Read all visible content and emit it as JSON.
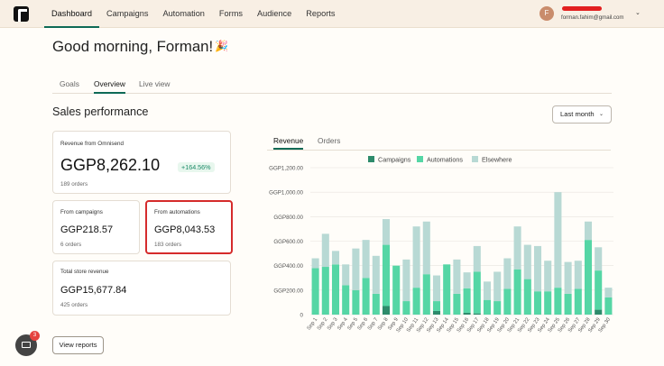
{
  "nav": {
    "items": [
      "Dashboard",
      "Campaigns",
      "Automation",
      "Forms",
      "Audience",
      "Reports"
    ]
  },
  "user": {
    "initial": "F",
    "email": "forman.fahim@gmail.com"
  },
  "greeting": "Good morning, Forman!",
  "tabs": [
    "Goals",
    "Overview",
    "Live view"
  ],
  "sales": {
    "title": "Sales performance",
    "period": "Last month",
    "revenue_omnisend": {
      "label": "Revenue from Omnisend",
      "value": "GGP8,262.10",
      "change": "+164.56%",
      "orders": "189 orders"
    },
    "campaigns": {
      "label": "From campaigns",
      "value": "GGP218.57",
      "orders": "6 orders"
    },
    "automations": {
      "label": "From automations",
      "value": "GGP8,043.53",
      "orders": "183 orders"
    },
    "store": {
      "label": "Total store revenue",
      "value": "GGP15,677.84",
      "orders": "425 orders"
    },
    "view_reports": "View reports"
  },
  "chart_tabs": [
    "Revenue",
    "Orders"
  ],
  "colors": {
    "campaigns": "#2e8b6b",
    "automations": "#55d6a5",
    "elsewhere": "#b8d9d4"
  },
  "chat_badge": "3",
  "chart_data": {
    "type": "bar",
    "stacked": true,
    "legend": [
      "Campaigns",
      "Automations",
      "Elsewhere"
    ],
    "yticks": [
      "GGP1,200.00",
      "GGP1,000.00",
      "GGP800.00",
      "GGP600.00",
      "GGP400.00",
      "GGP200.00",
      "0"
    ],
    "ylim": [
      0,
      1200
    ],
    "categories": [
      "Sep 1",
      "Sep 2",
      "Sep 3",
      "Sep 4",
      "Sep 5",
      "Sep 6",
      "Sep 7",
      "Sep 8",
      "Sep 9",
      "Sep 10",
      "Sep 11",
      "Sep 12",
      "Sep 13",
      "Sep 14",
      "Sep 15",
      "Sep 16",
      "Sep 17",
      "Sep 18",
      "Sep 19",
      "Sep 20",
      "Sep 21",
      "Sep 22",
      "Sep 23",
      "Sep 24",
      "Sep 25",
      "Sep 26",
      "Sep 27",
      "Sep 28",
      "Sep 29",
      "Sep 30"
    ],
    "series": [
      {
        "name": "Campaigns",
        "values": [
          0,
          0,
          0,
          0,
          0,
          0,
          0,
          70,
          0,
          0,
          0,
          0,
          30,
          0,
          0,
          15,
          10,
          0,
          0,
          0,
          0,
          0,
          0,
          0,
          0,
          0,
          0,
          0,
          40,
          0
        ]
      },
      {
        "name": "Automations",
        "values": [
          380,
          390,
          410,
          240,
          200,
          300,
          170,
          500,
          400,
          110,
          220,
          330,
          80,
          410,
          170,
          200,
          340,
          120,
          110,
          210,
          370,
          290,
          190,
          190,
          220,
          170,
          210,
          610,
          320,
          140
        ]
      },
      {
        "name": "Elsewhere",
        "values": [
          80,
          270,
          110,
          170,
          340,
          310,
          310,
          210,
          0,
          340,
          500,
          430,
          210,
          0,
          280,
          130,
          210,
          150,
          240,
          250,
          350,
          280,
          370,
          250,
          780,
          260,
          230,
          150,
          190,
          80
        ]
      }
    ]
  }
}
